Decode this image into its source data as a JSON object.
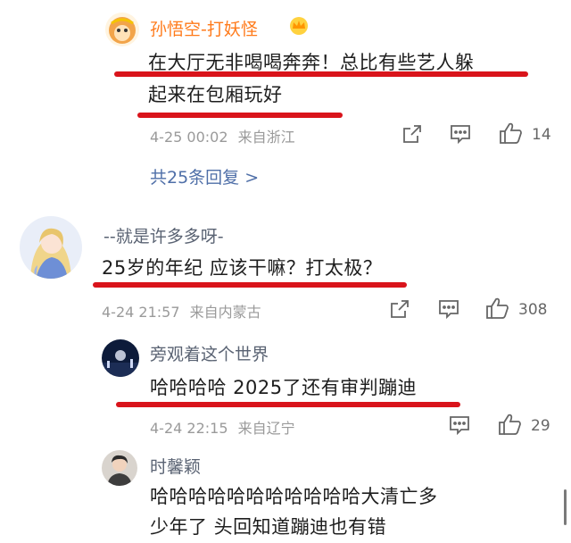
{
  "comments": [
    {
      "name": "孙悟空-打妖怪",
      "line1": "在大厅无非喝喝奔奔！总比有些艺人躲",
      "line2": "起来在包厢玩好",
      "time": "4-25 00:02",
      "location": "来自浙江",
      "likes": "14",
      "replies_link": "共25条回复 >",
      "badge_icon": "crown-icon",
      "colors": {
        "name": "#ff7a1a"
      }
    },
    {
      "name": "--就是许多多呀-",
      "line1": "25岁的年纪 应该干嘛？打太极？",
      "time": "4-24 21:57",
      "location": "来自内蒙古",
      "likes": "308"
    }
  ],
  "replies": [
    {
      "name": "旁观着这个世界",
      "line1": "哈哈哈哈 2025了还有审判蹦迪",
      "time": "4-24 22:15",
      "location": "来自辽宁",
      "likes": "29"
    },
    {
      "name": "时馨颖",
      "line1": "哈哈哈哈哈哈哈哈哈哈哈大清亡多",
      "line2": "少年了 头回知道蹦迪也有错"
    }
  ],
  "colors": {
    "underline": "#d9141b",
    "link": "#4f6fa8",
    "meta": "#9a9a9a"
  }
}
